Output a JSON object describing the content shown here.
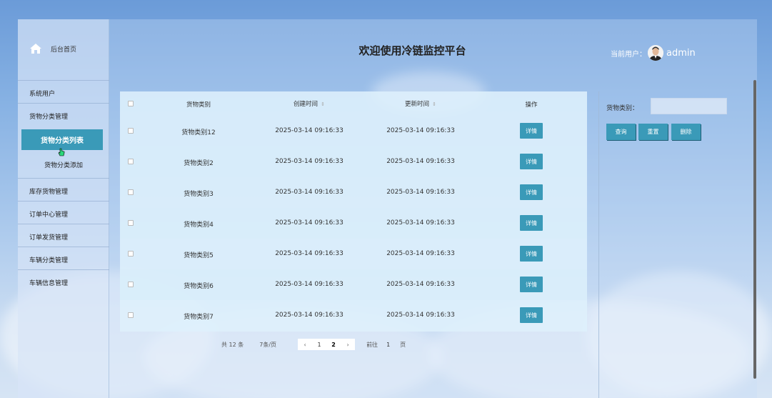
{
  "header": {
    "title": "欢迎使用冷链监控平台",
    "user_label": "当前用户：",
    "user_name": "admin"
  },
  "sidebar": {
    "home_label": "后台首页",
    "items": [
      {
        "label": "系统用户"
      },
      {
        "label": "货物分类管理"
      },
      {
        "label": "库存货物管理"
      },
      {
        "label": "订单中心管理"
      },
      {
        "label": "订单发货管理"
      },
      {
        "label": "车辆分类管理"
      },
      {
        "label": "车辆信息管理"
      }
    ],
    "sub_items": [
      {
        "label": "货物分类列表",
        "active": true
      },
      {
        "label": "货物分类添加",
        "active": false
      }
    ]
  },
  "table": {
    "columns": [
      "货物类别",
      "创建时间",
      "更新时间",
      "操作"
    ],
    "rows": [
      {
        "category": "货物类别12",
        "created": "2025-03-14 09:16:33",
        "updated": "2025-03-14 09:16:33",
        "action": "详情"
      },
      {
        "category": "货物类别2",
        "created": "2025-03-14 09:16:33",
        "updated": "2025-03-14 09:16:33",
        "action": "详情"
      },
      {
        "category": "货物类别3",
        "created": "2025-03-14 09:16:33",
        "updated": "2025-03-14 09:16:33",
        "action": "详情"
      },
      {
        "category": "货物类别4",
        "created": "2025-03-14 09:16:33",
        "updated": "2025-03-14 09:16:33",
        "action": "详情"
      },
      {
        "category": "货物类别5",
        "created": "2025-03-14 09:16:33",
        "updated": "2025-03-14 09:16:33",
        "action": "详情"
      },
      {
        "category": "货物类别6",
        "created": "2025-03-14 09:16:33",
        "updated": "2025-03-14 09:16:33",
        "action": "详情"
      },
      {
        "category": "货物类别7",
        "created": "2025-03-14 09:16:33",
        "updated": "2025-03-14 09:16:33",
        "action": "详情"
      }
    ]
  },
  "pagination": {
    "total": "共 12 条",
    "page_size": "7条/页",
    "pages": [
      "1",
      "2"
    ],
    "current_page": "2",
    "goto_label": "前往",
    "goto_value": "1",
    "page_suffix": "页"
  },
  "filter": {
    "label": "货物类别：",
    "input_value": "",
    "buttons": [
      "查询",
      "重置",
      "删除"
    ]
  },
  "colors": {
    "accent": "#3a9ab8"
  }
}
